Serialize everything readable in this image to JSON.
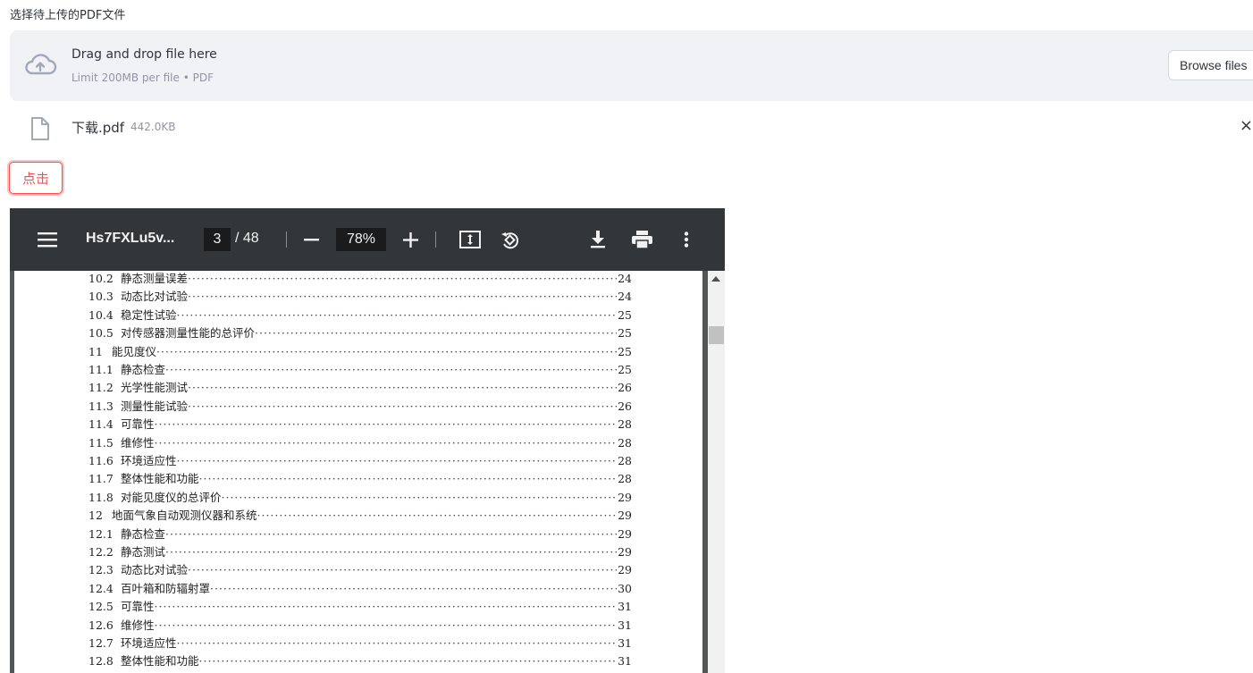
{
  "uploader": {
    "label": "选择待上传的PDF文件",
    "drop_title": "Drag and drop file here",
    "limit_text": "Limit 200MB per file • PDF",
    "browse_label": "Browse files",
    "cloud_icon": "cloud-upload-icon"
  },
  "uploaded_file": {
    "name": "下载.pdf",
    "size": "442.0KB",
    "close_glyph": "×",
    "icon": "file-icon"
  },
  "click_button": {
    "label": "点击",
    "color": "#ff4b4b"
  },
  "pdf_viewer": {
    "title": "Hs7FXLu5v...",
    "current_page": "3",
    "page_separator": "/ 48",
    "zoom": "78%",
    "toolbar_icons": [
      "menu-icon",
      "zoom-out-icon",
      "zoom-in-icon",
      "fit-page-icon",
      "rotate-icon",
      "download-icon",
      "print-icon",
      "more-icon"
    ],
    "toc": [
      {
        "num": "10.2",
        "title": "静态测量误差",
        "page": "24"
      },
      {
        "num": "10.3",
        "title": "动态比对试验",
        "page": "24"
      },
      {
        "num": "10.4",
        "title": "稳定性试验",
        "page": "25"
      },
      {
        "num": "10.5",
        "title": "对传感器测量性能的总评价",
        "page": "25"
      },
      {
        "num": "11",
        "title": "能见度仪",
        "page": "25"
      },
      {
        "num": "11.1",
        "title": "静态检查",
        "page": "25"
      },
      {
        "num": "11.2",
        "title": "光学性能测试",
        "page": "26"
      },
      {
        "num": "11.3",
        "title": "测量性能试验",
        "page": "26"
      },
      {
        "num": "11.4",
        "title": "可靠性",
        "page": "28"
      },
      {
        "num": "11.5",
        "title": "维修性",
        "page": "28"
      },
      {
        "num": "11.6",
        "title": "环境适应性",
        "page": "28"
      },
      {
        "num": "11.7",
        "title": "整体性能和功能",
        "page": "28"
      },
      {
        "num": "11.8",
        "title": "对能见度仪的总评价",
        "page": "29"
      },
      {
        "num": "12",
        "title": "地面气象自动观测仪器和系统",
        "page": "29"
      },
      {
        "num": "12.1",
        "title": "静态检查",
        "page": "29"
      },
      {
        "num": "12.2",
        "title": "静态测试",
        "page": "29"
      },
      {
        "num": "12.3",
        "title": "动态比对试验",
        "page": "29"
      },
      {
        "num": "12.4",
        "title": "百叶箱和防辐射罩",
        "page": "30"
      },
      {
        "num": "12.5",
        "title": "可靠性",
        "page": "31"
      },
      {
        "num": "12.6",
        "title": "维修性",
        "page": "31"
      },
      {
        "num": "12.7",
        "title": "环境适应性",
        "page": "31"
      },
      {
        "num": "12.8",
        "title": "整体性能和功能",
        "page": "31"
      }
    ]
  }
}
